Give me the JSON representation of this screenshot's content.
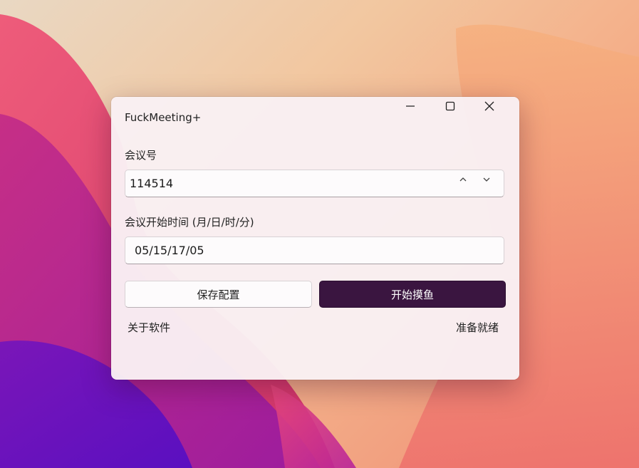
{
  "window": {
    "title": "FuckMeeting+",
    "controls": {
      "minimize_icon": "minimize-icon",
      "maximize_icon": "maximize-icon",
      "close_icon": "close-icon"
    }
  },
  "form": {
    "meeting_id": {
      "label": "会议号",
      "value": "114514",
      "increment_icon": "chevron-up-icon",
      "decrement_icon": "chevron-down-icon"
    },
    "start_time": {
      "label": "会议开始时间 (月/日/时/分)",
      "value": "05/15/17/05"
    }
  },
  "actions": {
    "save_label": "保存配置",
    "start_label": "开始摸鱼"
  },
  "footer": {
    "about_label": "关于软件",
    "status_text": "准备就绪"
  },
  "colors": {
    "accent": "#3a1540",
    "window_bg": "#f9f0f3"
  }
}
